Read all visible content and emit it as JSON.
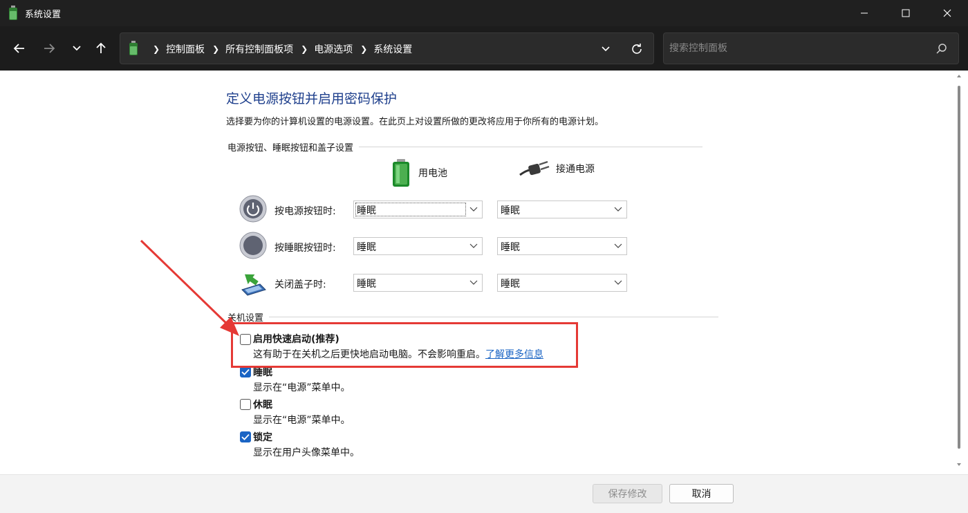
{
  "window": {
    "title": "系统设置",
    "minimize_icon": "minimize-icon",
    "maximize_icon": "maximize-icon",
    "close_icon": "close-icon"
  },
  "nav": {
    "breadcrumbs": [
      "控制面板",
      "所有控制面板项",
      "电源选项",
      "系统设置"
    ],
    "search_placeholder": "搜索控制面板"
  },
  "main": {
    "title": "定义电源按钮并启用密码保护",
    "description": "选择要为你的计算机设置的电源设置。在此页上对设置所做的更改将应用于你所有的电源计划。",
    "buttons_group": {
      "heading": "电源按钮、睡眠按钮和盖子设置",
      "col_battery": "用电池",
      "col_plugged": "接通电源",
      "rows": [
        {
          "label": "按电源按钮时:",
          "battery": "睡眠",
          "plugged": "睡眠"
        },
        {
          "label": "按睡眠按钮时:",
          "battery": "睡眠",
          "plugged": "睡眠"
        },
        {
          "label": "关闭盖子时:",
          "battery": "睡眠",
          "plugged": "睡眠"
        }
      ]
    },
    "shutdown_group": {
      "heading": "关机设置",
      "options": [
        {
          "title": "启用快速启动(推荐)",
          "desc": "这有助于在关机之后更快地启动电脑。不会影响重启。",
          "link": "了解更多信息",
          "checked": false
        },
        {
          "title": "睡眠",
          "desc": "显示在“电源”菜单中。",
          "checked": true
        },
        {
          "title": "休眠",
          "desc": "显示在“电源”菜单中。",
          "checked": false
        },
        {
          "title": "锁定",
          "desc": "显示在用户头像菜单中。",
          "checked": true
        }
      ]
    }
  },
  "footer": {
    "save_label": "保存修改",
    "cancel_label": "取消"
  },
  "colors": {
    "title_blue": "#1e3f8c",
    "link_blue": "#1a64c4",
    "annotation_red": "#e53935"
  }
}
